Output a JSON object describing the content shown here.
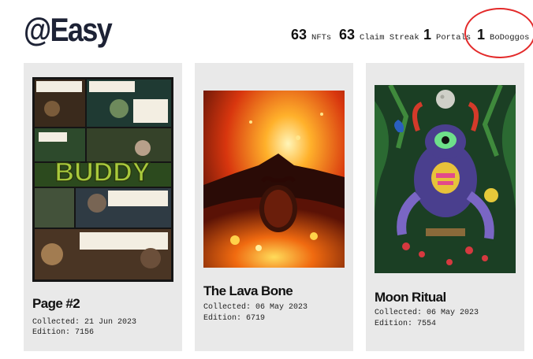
{
  "profile": {
    "username": "@Easy"
  },
  "stats": [
    {
      "value": "63",
      "label": "NFTs"
    },
    {
      "value": "63",
      "label": "Claim Streak"
    },
    {
      "value": "1",
      "label": "Portals"
    },
    {
      "value": "1",
      "label": "BoDoggos"
    }
  ],
  "cards": [
    {
      "title": "Page #2",
      "collected": "Collected: 21 Jun 2023",
      "edition": "Edition: 7156",
      "art_word": "BUDDY"
    },
    {
      "title": "The Lava Bone",
      "collected": "Collected: 06 May 2023",
      "edition": "Edition: 6719"
    },
    {
      "title": "Moon Ritual",
      "collected": "Collected: 06 May 2023",
      "edition": "Edition: 7554"
    }
  ],
  "colors": {
    "highlight": "#e32a2a",
    "card_bg": "#e9e9e9",
    "username": "#1d2235"
  }
}
